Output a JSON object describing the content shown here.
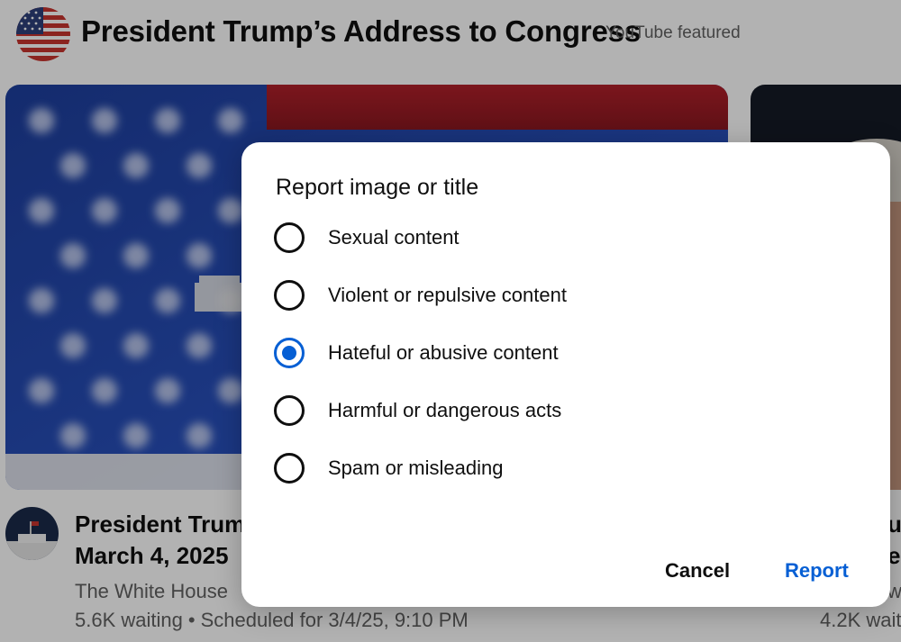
{
  "header": {
    "title": "President Trump’s Address to Congress",
    "featured_tag": "YouTube featured"
  },
  "video": {
    "title_visible": "President Trump",
    "date": "March 4, 2025",
    "channel": "The White House",
    "waiting": "5.6K waiting",
    "separator": "•",
    "scheduled": "Scheduled for 3/4/25, 9:10 PM"
  },
  "side_video": {
    "title_frag1": "u",
    "title_frag2": "es",
    "meta_frag1": "w",
    "meta_frag2": "4.2K wait"
  },
  "dialog": {
    "title": "Report image or title",
    "options": [
      {
        "label": "Sexual content",
        "selected": false
      },
      {
        "label": "Violent or repulsive content",
        "selected": false
      },
      {
        "label": "Hateful or abusive content",
        "selected": true
      },
      {
        "label": "Harmful or dangerous acts",
        "selected": false
      },
      {
        "label": "Spam or misleading",
        "selected": false
      }
    ],
    "cancel_label": "Cancel",
    "report_label": "Report"
  },
  "colors": {
    "accent": "#065fd4",
    "text": "#0f0f0f",
    "secondary_text": "#606060"
  }
}
